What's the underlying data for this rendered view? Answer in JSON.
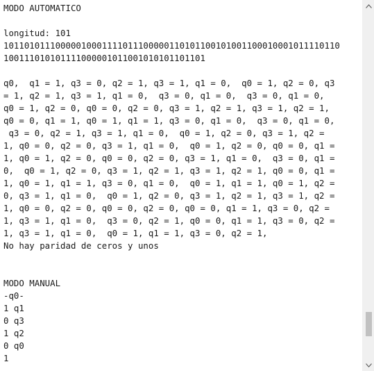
{
  "output": {
    "lines": [
      "MODO AUTOMATICO",
      "",
      "longitud: 101",
      "10110101110000010001111011100000110101100101001100010001011110110",
      "100111010101111000001011001010101101101",
      "",
      "q0,  q1 = 1, q3 = 0, q2 = 1, q3 = 1, q1 = 0,  q0 = 1, q2 = 0, q3",
      "= 1, q2 = 1, q3 = 1, q1 = 0,  q3 = 0, q1 = 0,  q3 = 0, q1 = 0,",
      "q0 = 1, q2 = 0, q0 = 0, q2 = 0, q3 = 1, q2 = 1, q3 = 1, q2 = 1,",
      "q0 = 0, q1 = 1, q0 = 1, q1 = 1, q3 = 0, q1 = 0,  q3 = 0, q1 = 0,",
      " q3 = 0, q2 = 1, q3 = 1, q1 = 0,  q0 = 1, q2 = 0, q3 = 1, q2 =",
      "1, q0 = 0, q2 = 0, q3 = 1, q1 = 0,  q0 = 1, q2 = 0, q0 = 0, q1 =",
      "1, q0 = 1, q2 = 0, q0 = 0, q2 = 0, q3 = 1, q1 = 0,  q3 = 0, q1 =",
      "0,  q0 = 1, q2 = 0, q3 = 1, q2 = 1, q3 = 1, q2 = 1, q0 = 0, q1 =",
      "1, q0 = 1, q1 = 1, q3 = 0, q1 = 0,  q0 = 1, q1 = 1, q0 = 1, q2 =",
      "0, q3 = 1, q1 = 0,  q0 = 1, q2 = 0, q3 = 1, q2 = 1, q3 = 1, q2 =",
      "1, q0 = 0, q2 = 0, q0 = 0, q2 = 0, q0 = 0, q1 = 1, q3 = 0, q2 =",
      "1, q3 = 1, q1 = 0,  q3 = 0, q2 = 1, q0 = 0, q1 = 1, q3 = 0, q2 =",
      "1, q3 = 1, q1 = 0,  q0 = 1, q1 = 1, q3 = 0, q2 = 1,",
      "No hay paridad de ceros y unos",
      "",
      "",
      "MODO MANUAL",
      "-q0-",
      "1 q1",
      "0 q3",
      "1 q2",
      "0 q0",
      "1"
    ]
  },
  "scrollbar": {
    "thumb_position": 0.93,
    "thumb_fraction": 0.07
  },
  "colors": {
    "text": "#1a1a1a",
    "background": "#ffffff",
    "scrollbar_track": "#f0f0f0",
    "scrollbar_thumb": "#c1c1c1",
    "arrow": "#606060"
  },
  "icons": {
    "scroll_up": "triangle-up-icon",
    "scroll_down": "triangle-down-icon"
  }
}
